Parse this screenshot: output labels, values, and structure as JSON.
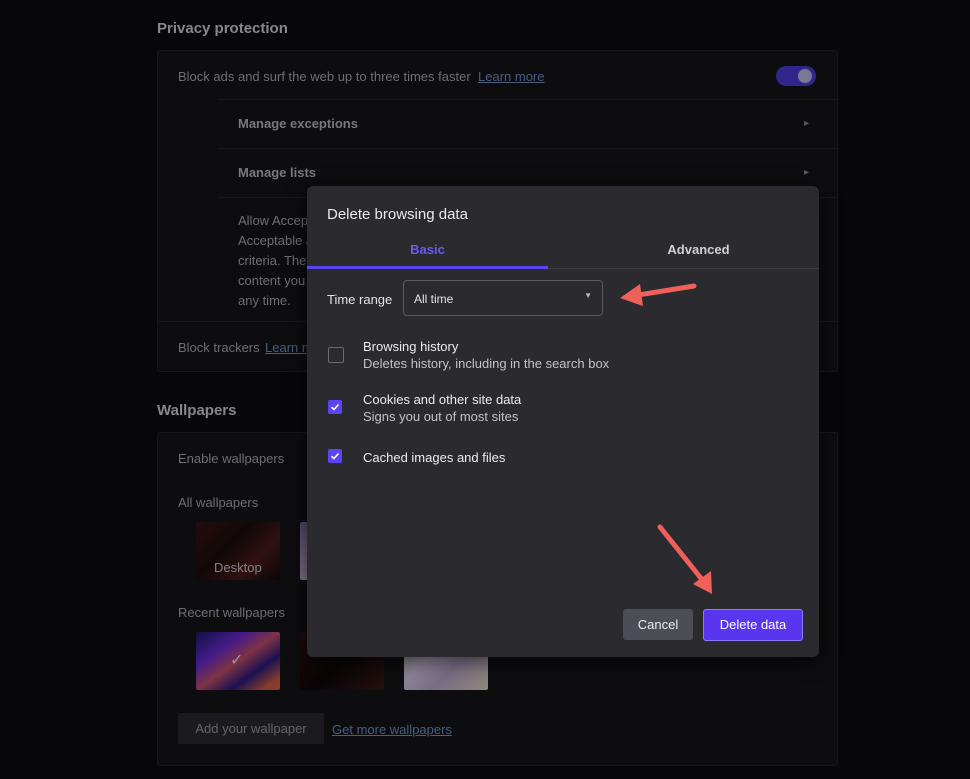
{
  "privacy": {
    "heading": "Privacy protection",
    "block_ads_text": "Block ads and surf the web up to three times faster",
    "learn_more": "Learn more",
    "toggle_on": true,
    "manage_exceptions": "Manage exceptions",
    "manage_lists": "Manage lists",
    "acceptable_lines": [
      "Allow Accep",
      "Acceptable a",
      "criteria. They",
      "content you",
      "any time."
    ],
    "block_trackers": "Block trackers",
    "block_trackers_link": "Learn m"
  },
  "wallpapers": {
    "heading": "Wallpapers",
    "enable": "Enable wallpapers",
    "all": "All wallpapers",
    "desktop_label": "Desktop",
    "recent": "Recent wallpapers",
    "add_button": "Add your wallpaper",
    "get_more": "Get more wallpapers"
  },
  "dialog": {
    "title": "Delete browsing data",
    "tabs": {
      "basic": "Basic",
      "advanced": "Advanced"
    },
    "time_range_label": "Time range",
    "time_range_value": "All time",
    "options": [
      {
        "title": "Browsing history",
        "sub": "Deletes history, including in the search box",
        "checked": false
      },
      {
        "title": "Cookies and other site data",
        "sub": "Signs you out of most sites",
        "checked": true
      },
      {
        "title": "Cached images and files",
        "sub": "",
        "checked": true
      }
    ],
    "cancel": "Cancel",
    "delete": "Delete data"
  },
  "colors": {
    "accent": "#5a45f5",
    "arrow": "#f0605a"
  }
}
